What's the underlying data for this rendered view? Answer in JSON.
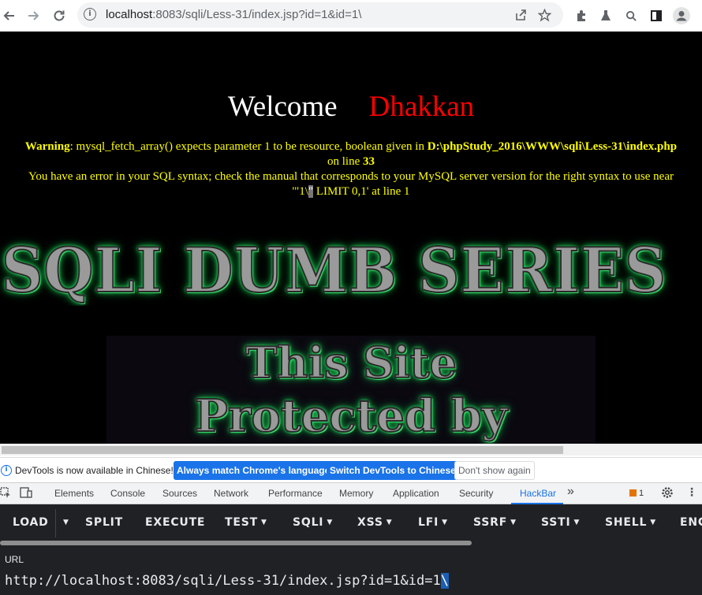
{
  "browser": {
    "url_host": "localhost",
    "url_rest": ":8083/sqli/Less-31/index.jsp?id=1&id=1\\",
    "icons": [
      "back-arrow-icon",
      "forward-arrow-icon",
      "reload-icon",
      "site-info-icon",
      "share-icon",
      "bookmark-star-icon",
      "extensions-puzzle-icon",
      "lab-flask-icon",
      "search-icon",
      "side-panel-icon",
      "profile-icon"
    ]
  },
  "page": {
    "welcome": "Welcome",
    "name": "Dhakkan",
    "warning_label": "Warning",
    "warning_text": ": mysql_fetch_array() expects parameter 1 to be resource, boolean given in ",
    "warning_path": "D:\\phpStudy_2016\\WWW\\sqli\\Less-31\\index.php",
    "warning_online": " on line ",
    "warning_line": "33",
    "sql_error": "You have an error in your SQL syntax; check the manual that corresponds to your MySQL server version for the right syntax to use near",
    "sql_near_a": "'\"1\\",
    "sql_near_b": "\"",
    "sql_near_c": " LIMIT 0,1' at line 1",
    "banner": "SQLI DUMB SERIES",
    "protect_line1": "This Site",
    "protect_line2": "Protected by"
  },
  "infobar": {
    "message": "DevTools is now available in Chinese!",
    "btn_match": "Always match Chrome's language",
    "btn_switch": "Switch DevTools to Chinese",
    "btn_dismiss": "Don't show again"
  },
  "devtools": {
    "tabs": [
      "Elements",
      "Console",
      "Sources",
      "Network",
      "Performance",
      "Memory",
      "Application",
      "Security",
      "HackBar"
    ],
    "more": "»",
    "issues_count": "1",
    "accent": "#1a73e8"
  },
  "hackbar": {
    "buttons": [
      "LOAD",
      "SPLIT",
      "EXECUTE",
      "TEST",
      "SQLI",
      "XSS",
      "LFI",
      "SSRF",
      "SSTI",
      "SHELL",
      "ENC"
    ],
    "url_label": "URL",
    "url_value": "http://localhost:8083/sqli/Less-31/index.jsp?id=1&id=1",
    "url_selected": "\\"
  }
}
